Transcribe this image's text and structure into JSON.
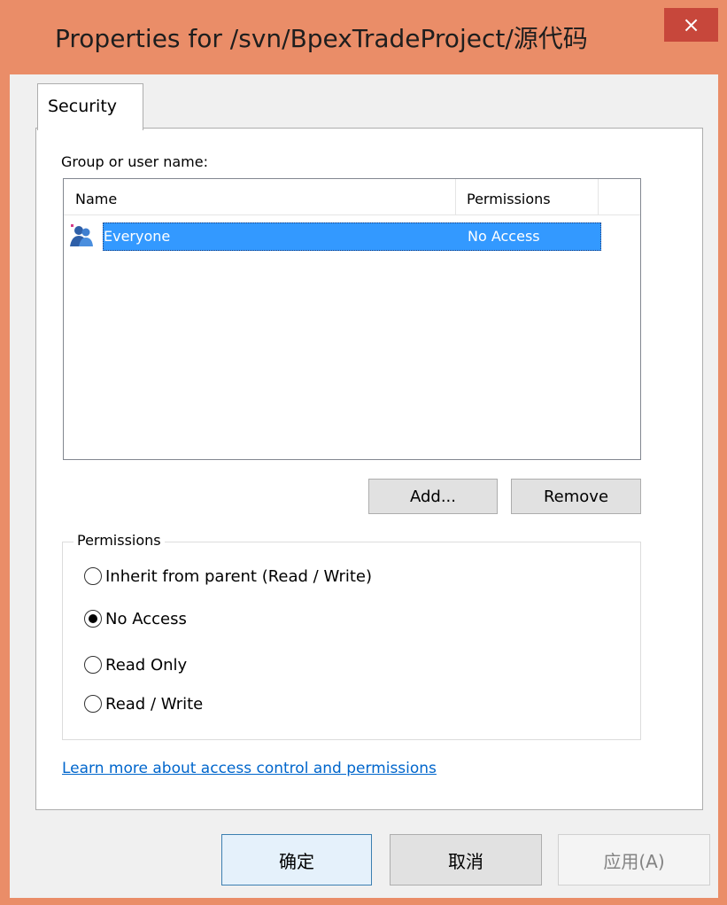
{
  "window": {
    "title": "Properties for /svn/BpexTradeProject/源代码",
    "close_label": "×"
  },
  "tabs": [
    {
      "label": "Security"
    }
  ],
  "security": {
    "group_label": "Group or user name:",
    "columns": {
      "name": "Name",
      "permissions": "Permissions"
    },
    "rows": [
      {
        "name": "Everyone",
        "permissions": "No Access",
        "icon": "group-icon"
      }
    ],
    "add_label": "Add...",
    "remove_label": "Remove",
    "permissions_legend": "Permissions",
    "options": [
      {
        "label": "Inherit from parent (Read / Write)",
        "checked": false
      },
      {
        "label": "No Access",
        "checked": true
      },
      {
        "label": "Read Only",
        "checked": false
      },
      {
        "label": "Read / Write",
        "checked": false
      }
    ],
    "link_label": "Learn more about access control and permissions"
  },
  "footer": {
    "ok_label": "确定",
    "cancel_label": "取消",
    "apply_label": "应用(A)"
  },
  "colors": {
    "frame": "#ea8d68",
    "close": "#c7473b",
    "selection": "#3399ff",
    "link": "#0066cc"
  }
}
